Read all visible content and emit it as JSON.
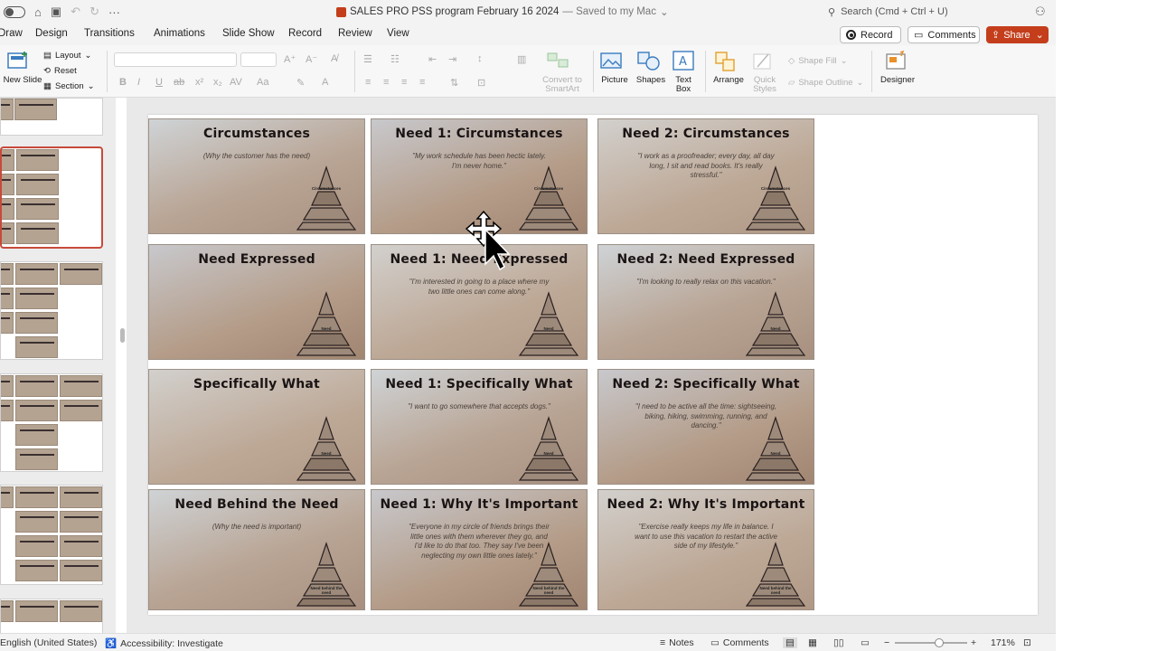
{
  "titlebar": {
    "title": "SALES PRO PSS program February 16 2024",
    "saved": "— Saved to my Mac",
    "search_placeholder": "Search (Cmd + Ctrl + U)"
  },
  "tabs": [
    "Draw",
    "Design",
    "Transitions",
    "Animations",
    "Slide Show",
    "Record",
    "Review",
    "View"
  ],
  "actions": {
    "record": "Record",
    "comments": "Comments",
    "share": "Share"
  },
  "ribbon": {
    "new_slide": "New Slide",
    "layout": "Layout",
    "reset": "Reset",
    "section": "Section",
    "convert_smartart": "Convert to SmartArt",
    "picture": "Picture",
    "shapes": "Shapes",
    "text_box": "Text Box",
    "arrange": "Arrange",
    "quick_styles": "Quick Styles",
    "shape_fill": "Shape Fill",
    "shape_outline": "Shape Outline",
    "designer": "Designer"
  },
  "cards": [
    {
      "title": "Circumstances",
      "body": "(Why the customer has the need)",
      "pyramid_label": "Circumstances",
      "tier": 1
    },
    {
      "title": "Need 1: Circumstances",
      "body": "\"My work schedule has been hectic lately. I'm never home.\"",
      "pyramid_label": "Circumstances",
      "tier": 1
    },
    {
      "title": "Need 2: Circumstances",
      "body": "\"I work as a proofreader; every day, all day long, I sit and read books. It's really stressful.\"",
      "pyramid_label": "Circumstances",
      "tier": 1
    },
    {
      "title": "Need Expressed",
      "body": "",
      "pyramid_label": "Need",
      "tier": 2
    },
    {
      "title": "Need 1: Need Expressed",
      "body": "\"I'm interested in going to a place where my two little ones can come along.\"",
      "pyramid_label": "Need",
      "tier": 2
    },
    {
      "title": "Need 2: Need Expressed",
      "body": "\"I'm looking to really relax on this vacation.\"",
      "pyramid_label": "Need",
      "tier": 2
    },
    {
      "title": "Specifically What",
      "body": "",
      "pyramid_label": "Need",
      "tier": 2
    },
    {
      "title": "Need 1: Specifically What",
      "body": "\"I want to go somewhere that accepts dogs.\"",
      "pyramid_label": "Need",
      "tier": 2
    },
    {
      "title": "Need 2: Specifically What",
      "body": "\"I need to be active all the time: sightseeing, biking, hiking, swimming, running, and dancing.\"",
      "pyramid_label": "Need",
      "tier": 2
    },
    {
      "title": "Need Behind the Need",
      "body": "(Why the need is important)",
      "pyramid_label": "Need behind the need",
      "tier": 3
    },
    {
      "title": "Need 1: Why It's Important",
      "body": "\"Everyone in my circle of friends brings their little ones with them wherever they go, and I'd like to do that too. They say I've been neglecting my own little ones lately.\"",
      "pyramid_label": "Need behind the need",
      "tier": 3
    },
    {
      "title": "Need 2: Why It's Important",
      "body": "\"Exercise really keeps my life in balance. I want to use this vacation to restart the active side of my lifestyle.\"",
      "pyramid_label": "Need behind the need",
      "tier": 3
    }
  ],
  "status": {
    "language": "English (United States)",
    "accessibility": "Accessibility: Investigate",
    "notes": "Notes",
    "comments": "Comments",
    "zoom": "171%"
  }
}
